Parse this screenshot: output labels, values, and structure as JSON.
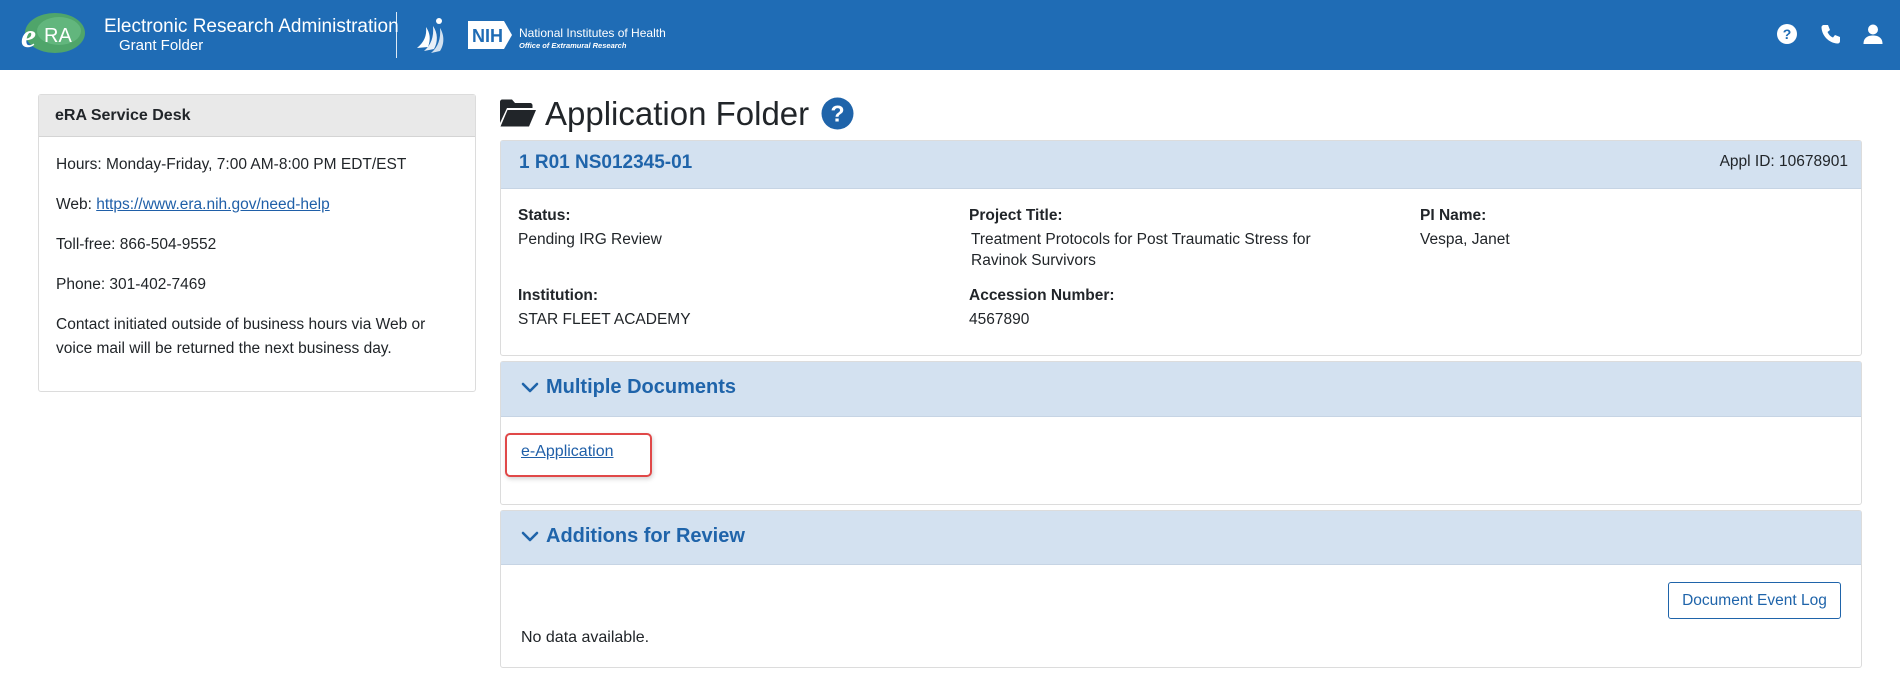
{
  "header": {
    "logo_text": "eRA",
    "app_title": "Electronic Research Administration",
    "app_subtitle": "Grant Folder",
    "nih_badge": "NIH",
    "nih_name": "National Institutes of Health",
    "nih_office": "Office of Extramural Research",
    "icons": [
      "help-icon",
      "phone-icon",
      "user-icon"
    ],
    "bar_color": "#1f6cb5"
  },
  "service_desk": {
    "title": "eRA Service Desk",
    "hours": "Hours: Monday-Friday, 7:00 AM-8:00 PM EDT/EST",
    "web_label": "Web: ",
    "web_link": "https://www.era.nih.gov/need-help",
    "tollfree": "Toll-free: 866-504-9552",
    "phone": "Phone: 301-402-7469",
    "note_line1": "Contact initiated outside of business hours via Web or",
    "note_line2": "voice mail will be returned the next business day."
  },
  "page": {
    "title": "Application Folder",
    "accent_color": "#1f64aa"
  },
  "application": {
    "grant_number": "1 R01 NS012345-01",
    "appl_id": "Appl ID: 10678901",
    "status_label": "Status:",
    "status_value": "Pending IRG Review",
    "project_title_label": "Project Title:",
    "project_title_line1": "Treatment Protocols for Post Traumatic Stress for",
    "project_title_line2": "Ravinok Survivors",
    "pi_label": "PI Name:",
    "pi_value": "Vespa, Janet",
    "institution_label": "Institution:",
    "institution_value": "STAR FLEET ACADEMY",
    "accession_label": "Accession Number:",
    "accession_value": "4567890"
  },
  "multiple_documents": {
    "title": "Multiple Documents",
    "link": "e-Application"
  },
  "additions": {
    "title": "Additions for Review",
    "button": "Document Event Log",
    "empty": "No data available."
  }
}
